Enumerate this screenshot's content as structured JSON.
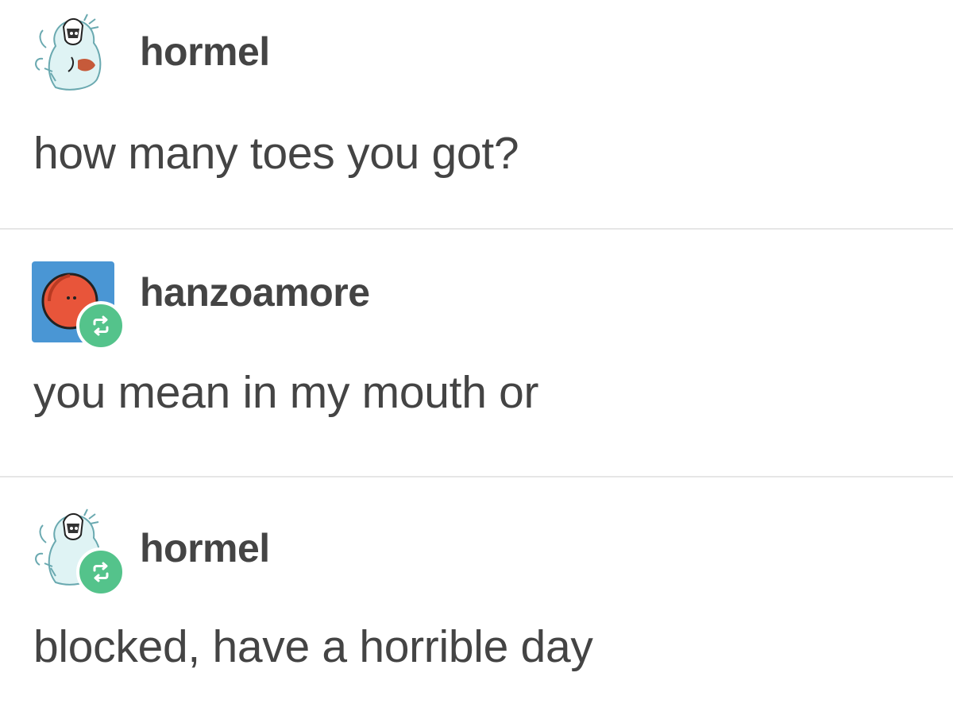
{
  "thread": {
    "posts": [
      {
        "username": "hormel",
        "avatar_icon": "ghost-character-avatar-icon",
        "reblogged": false,
        "text": "how many toes you got?"
      },
      {
        "username": "hanzoamore",
        "avatar_icon": "orange-circle-avatar-icon",
        "reblogged": true,
        "text": "you mean in my mouth or"
      },
      {
        "username": "hormel",
        "avatar_icon": "ghost-character-avatar-icon",
        "reblogged": true,
        "text": "blocked, have a horrible day"
      }
    ]
  },
  "colors": {
    "text": "#444444",
    "divider": "#e6e6e6",
    "reblog_badge": "#54c38b",
    "avatar_blue": "#4a96d4",
    "avatar_orange": "#e8553a"
  },
  "icons": {
    "reblog": "reblog-icon"
  }
}
